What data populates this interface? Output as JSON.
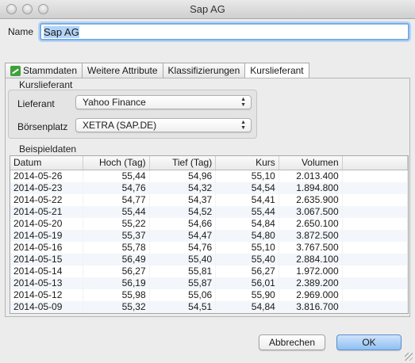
{
  "window": {
    "title": "Sap AG"
  },
  "name": {
    "label": "Name",
    "value": "Sap AG"
  },
  "tabs": [
    {
      "label": "Stammdaten",
      "icon": "chart-icon"
    },
    {
      "label": "Weitere Attribute"
    },
    {
      "label": "Klassifizierungen"
    },
    {
      "label": "Kurslieferant",
      "active": true
    }
  ],
  "kurslieferant": {
    "section_title": "Kurslieferant",
    "lieferant_label": "Lieferant",
    "lieferant_value": "Yahoo Finance",
    "boersenplatz_label": "Börsenplatz",
    "boersenplatz_value": "XETRA (SAP.DE)"
  },
  "beispieldaten": {
    "section_title": "Beispieldaten",
    "columns": [
      "Datum",
      "Hoch (Tag)",
      "Tief (Tag)",
      "Kurs",
      "Volumen"
    ],
    "rows": [
      [
        "2014-05-26",
        "55,44",
        "54,96",
        "55,10",
        "2.013.400"
      ],
      [
        "2014-05-23",
        "54,76",
        "54,32",
        "54,54",
        "1.894.800"
      ],
      [
        "2014-05-22",
        "54,77",
        "54,37",
        "54,41",
        "2.635.900"
      ],
      [
        "2014-05-21",
        "55,44",
        "54,52",
        "55,44",
        "3.067.500"
      ],
      [
        "2014-05-20",
        "55,22",
        "54,66",
        "54,84",
        "2.650.100"
      ],
      [
        "2014-05-19",
        "55,37",
        "54,47",
        "54,80",
        "3.872.500"
      ],
      [
        "2014-05-16",
        "55,78",
        "54,76",
        "55,10",
        "3.767.500"
      ],
      [
        "2014-05-15",
        "56,49",
        "55,40",
        "55,40",
        "2.884.100"
      ],
      [
        "2014-05-14",
        "56,27",
        "55,81",
        "56,27",
        "1.972.000"
      ],
      [
        "2014-05-13",
        "56,19",
        "55,87",
        "56,01",
        "2.389.200"
      ],
      [
        "2014-05-12",
        "55,98",
        "55,06",
        "55,90",
        "2.969.000"
      ],
      [
        "2014-05-09",
        "55,32",
        "54,51",
        "54,84",
        "3.816.700"
      ]
    ]
  },
  "buttons": {
    "cancel": "Abbrechen",
    "ok": "OK"
  }
}
